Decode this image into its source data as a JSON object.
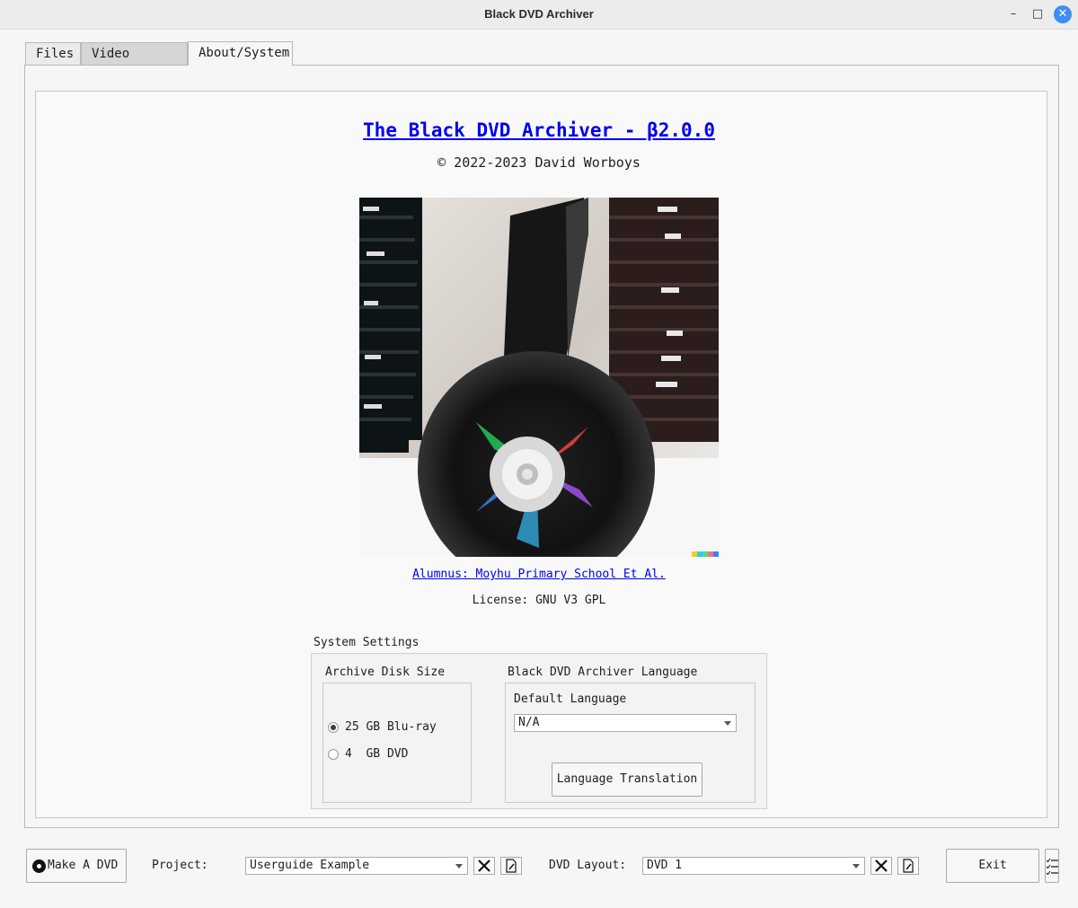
{
  "window": {
    "title": "Black DVD Archiver",
    "minimize": "–",
    "maximize": "□",
    "close": "✕"
  },
  "tabs": [
    {
      "label": "Files"
    },
    {
      "label": "Video Editor"
    },
    {
      "label": "About/System"
    }
  ],
  "about": {
    "title": "The Black DVD Archiver - β2.0.0",
    "copyright": "© 2022-2023 David Worboys",
    "alumnus": "Alumnus: Moyhu Primary School Et Al.",
    "license": "License: GNU V3 GPL"
  },
  "system_settings": {
    "label": "System Settings",
    "disk_size": {
      "label": "Archive Disk Size",
      "options": [
        {
          "label": "25 GB Blu-ray",
          "selected": true
        },
        {
          "label": "4  GB DVD",
          "selected": false
        }
      ]
    },
    "language": {
      "label": "Black DVD Archiver Language",
      "default_label": "Default Language",
      "value": "N/A",
      "translate_button": "Language Translation"
    }
  },
  "footer": {
    "make_dvd": "Make A DVD",
    "project_label": "Project:",
    "project_value": "Userguide Example",
    "layout_label": "DVD Layout:",
    "layout_value": "DVD 1",
    "exit": "Exit"
  },
  "icons": {
    "disc": "disc-icon",
    "delete": "delete-icon",
    "edit": "edit-file-icon",
    "checklist": "checklist-icon"
  }
}
